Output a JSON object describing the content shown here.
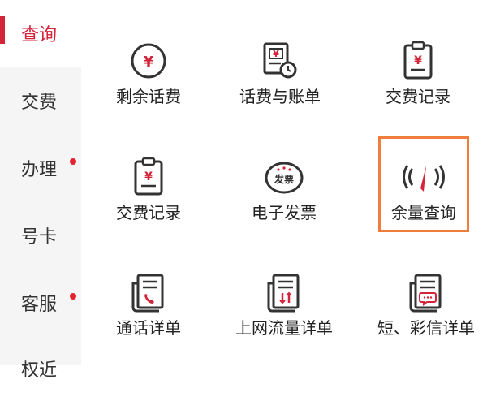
{
  "sidebar": {
    "items": [
      {
        "label": "查询",
        "active": true
      },
      {
        "label": "交费"
      },
      {
        "label": "办理",
        "badge": true
      },
      {
        "label": "号卡"
      },
      {
        "label": "客服",
        "badge": true
      },
      {
        "label": "权近"
      }
    ]
  },
  "grid": {
    "items": [
      {
        "label": "剩余话费",
        "icon": "yuan-circle-icon"
      },
      {
        "label": "话费与账单",
        "icon": "bill-clock-icon"
      },
      {
        "label": "交费记录",
        "icon": "clipboard-yuan-icon"
      },
      {
        "label": "交费记录",
        "icon": "clipboard-yuan-icon"
      },
      {
        "label": "电子发票",
        "icon": "invoice-stamp-icon"
      },
      {
        "label": "余量查询",
        "icon": "gauge-signal-icon",
        "highlighted": true
      },
      {
        "label": "通话详单",
        "icon": "call-detail-icon"
      },
      {
        "label": "上网流量详单",
        "icon": "data-flow-detail-icon"
      },
      {
        "label": "短、彩信详单",
        "icon": "sms-detail-icon"
      }
    ]
  },
  "icon_texts": {
    "invoice_stamp": "发票",
    "yuan": "¥"
  },
  "colors": {
    "accent": "#d4243a",
    "highlight_border": "#ef7d3c",
    "icon_stroke": "#333333",
    "sidebar_bg": "#f5f5f5"
  }
}
